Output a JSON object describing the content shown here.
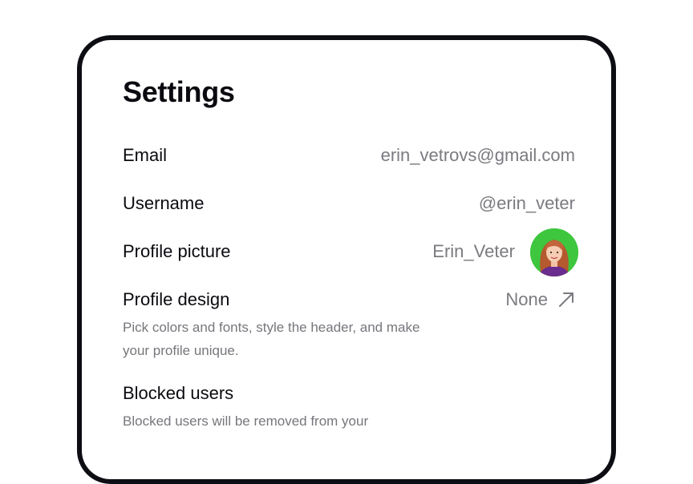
{
  "settings": {
    "title": "Settings",
    "email": {
      "label": "Email",
      "value": "erin_vetrovs@gmail.com"
    },
    "username": {
      "label": "Username",
      "value": "@erin_veter"
    },
    "profile_picture": {
      "label": "Profile picture",
      "value": "Erin_Veter",
      "avatar_bg": "#3ec63e"
    },
    "profile_design": {
      "label": "Profile design",
      "value": "None",
      "description": "Pick colors and fonts, style the header, and make your profile unique.",
      "icon": "arrow-up-right-icon"
    },
    "blocked_users": {
      "label": "Blocked users",
      "description": "Blocked users will be removed from your"
    }
  }
}
